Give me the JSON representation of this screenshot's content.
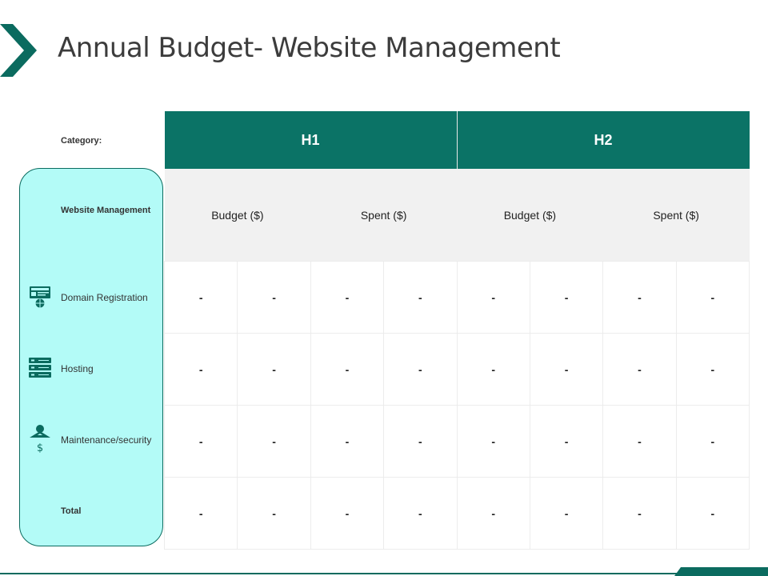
{
  "slide": {
    "title": "Annual Budget- Website Management",
    "category_label": "Category:",
    "accent_color": "#0b7366",
    "panel_color": "#b3fbf7"
  },
  "table": {
    "periods": [
      "H1",
      "H2"
    ],
    "subheaders": [
      "Budget ($)",
      "Spent ($)",
      "Budget ($)",
      "Spent ($)"
    ],
    "rows": [
      {
        "label": "Website Management",
        "icon": "",
        "cells": []
      },
      {
        "label": "Domain Registration",
        "icon": "domain-registration-icon",
        "cells": [
          "-",
          "-",
          "-",
          "-",
          "-",
          "-",
          "-",
          "-"
        ]
      },
      {
        "label": "Hosting",
        "icon": "server-rack-icon",
        "cells": [
          "-",
          "-",
          "-",
          "-",
          "-",
          "-",
          "-",
          "-"
        ]
      },
      {
        "label": "Maintenance/security",
        "icon": "maintenance-cost-icon",
        "cells": [
          "-",
          "-",
          "-",
          "-",
          "-",
          "-",
          "-",
          "-"
        ]
      },
      {
        "label": "Total",
        "icon": "",
        "cells": [
          "-",
          "-",
          "-",
          "-",
          "-",
          "-",
          "-",
          "-"
        ]
      }
    ]
  }
}
